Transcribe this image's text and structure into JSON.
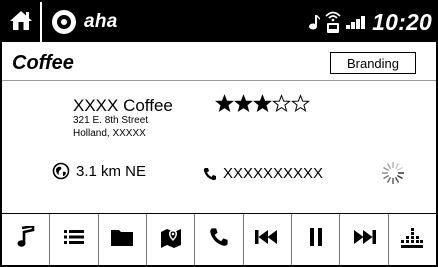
{
  "status_bar": {
    "app_name": "aha",
    "clock": "10:20",
    "icons": [
      "home-icon",
      "aha-logo-icon",
      "music-note-icon",
      "wifi-phone-icon",
      "signal-strength-icon"
    ]
  },
  "station": {
    "title": "Coffee",
    "branding_label": "Branding",
    "name": "XXXX Coffee",
    "address_line1": "321 E. 8th Street",
    "address_line2": "Holland, XXXXX",
    "rating": 3,
    "rating_max": 5,
    "distance": "3.1 km NE",
    "phone": "XXXXXXXXXX"
  },
  "toolbar": {
    "buttons": [
      {
        "name": "music-button",
        "icon": "music-note-icon"
      },
      {
        "name": "list-button",
        "icon": "list-icon"
      },
      {
        "name": "folder-button",
        "icon": "folder-icon"
      },
      {
        "name": "map-button",
        "icon": "map-icon"
      },
      {
        "name": "call-button",
        "icon": "phone-icon"
      },
      {
        "name": "previous-button",
        "icon": "skip-back-icon"
      },
      {
        "name": "pause-button",
        "icon": "pause-icon"
      },
      {
        "name": "next-button",
        "icon": "skip-forward-icon"
      },
      {
        "name": "equalizer-button",
        "icon": "equalizer-icon"
      }
    ]
  },
  "colors": {
    "bar_background": "#000000",
    "bar_foreground": "#ffffff",
    "divider": "#9a9a9a"
  }
}
